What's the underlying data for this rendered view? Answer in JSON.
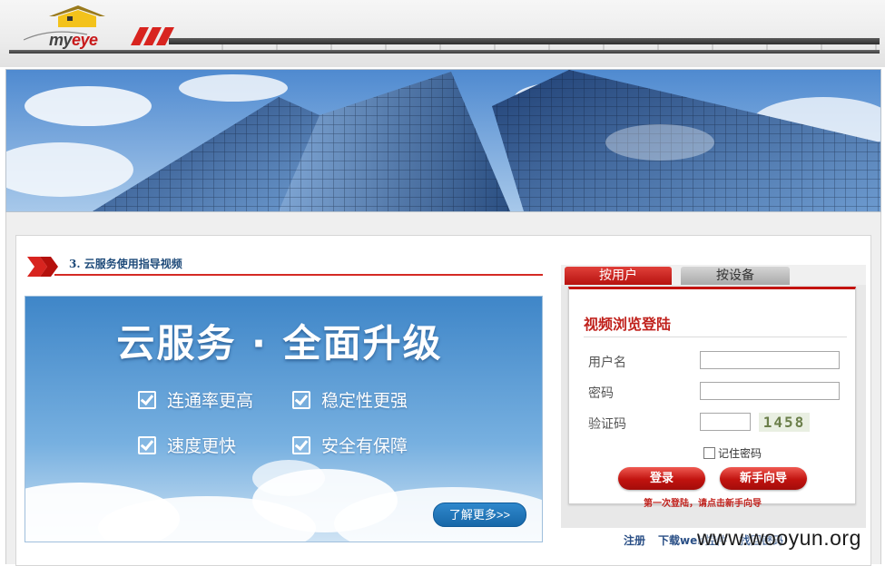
{
  "brand": {
    "logo_text_a": "my",
    "logo_text_b": "eye"
  },
  "video_section": {
    "title": "3. 云服务使用指导视频"
  },
  "promo": {
    "headline": "云服务 · 全面升级",
    "features": [
      "连通率更高",
      "稳定性更强",
      "速度更快",
      "安全有保障"
    ],
    "more_button": "了解更多>>"
  },
  "login": {
    "tabs": [
      "按用户",
      "按设备"
    ],
    "active_tab": "按用户",
    "title": "视频浏览登陆",
    "username_label": "用户名",
    "password_label": "密码",
    "captcha_label": "验证码",
    "username_value": "",
    "password_value": "",
    "captcha_value": "",
    "captcha_image_text": "1458",
    "remember_label": "记住密码",
    "login_button": "登录",
    "guide_button": "新手向导",
    "hint": "第一次登陆，请点击新手向导"
  },
  "footer_links": [
    "注册",
    "下载web控件",
    "找回密码"
  ],
  "watermark": "www.wooyun.org",
  "colors": {
    "accent_red": "#c3130f",
    "link_blue": "#2a4f86"
  }
}
